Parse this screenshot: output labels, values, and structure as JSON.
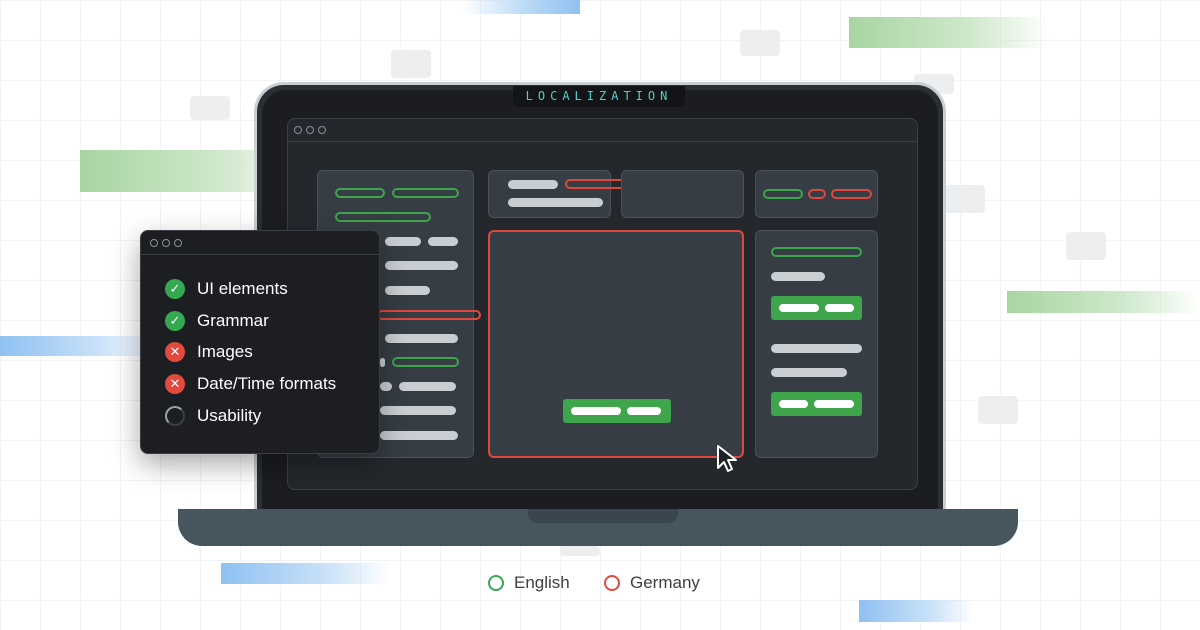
{
  "brand": {
    "label": "LOCALIZATION"
  },
  "checklist": {
    "items": [
      {
        "label": "UI elements",
        "status": "pass",
        "icon": "check-circle-icon"
      },
      {
        "label": "Grammar",
        "status": "pass",
        "icon": "check-circle-icon"
      },
      {
        "label": "Images",
        "status": "fail",
        "icon": "x-circle-icon"
      },
      {
        "label": "Date/Time formats",
        "status": "fail",
        "icon": "x-circle-icon"
      },
      {
        "label": "Usability",
        "status": "in-progress",
        "icon": "spinner-icon"
      }
    ]
  },
  "legend": {
    "items": [
      {
        "label": "English",
        "color": "#34a853"
      },
      {
        "label": "Germany",
        "color": "#e24a3d"
      }
    ]
  },
  "colors": {
    "pass": "#34a853",
    "fail": "#e24a3d",
    "screen_bg": "#24282d",
    "bezel": "#2b2e33",
    "accent_text": "#4fd1c5"
  }
}
